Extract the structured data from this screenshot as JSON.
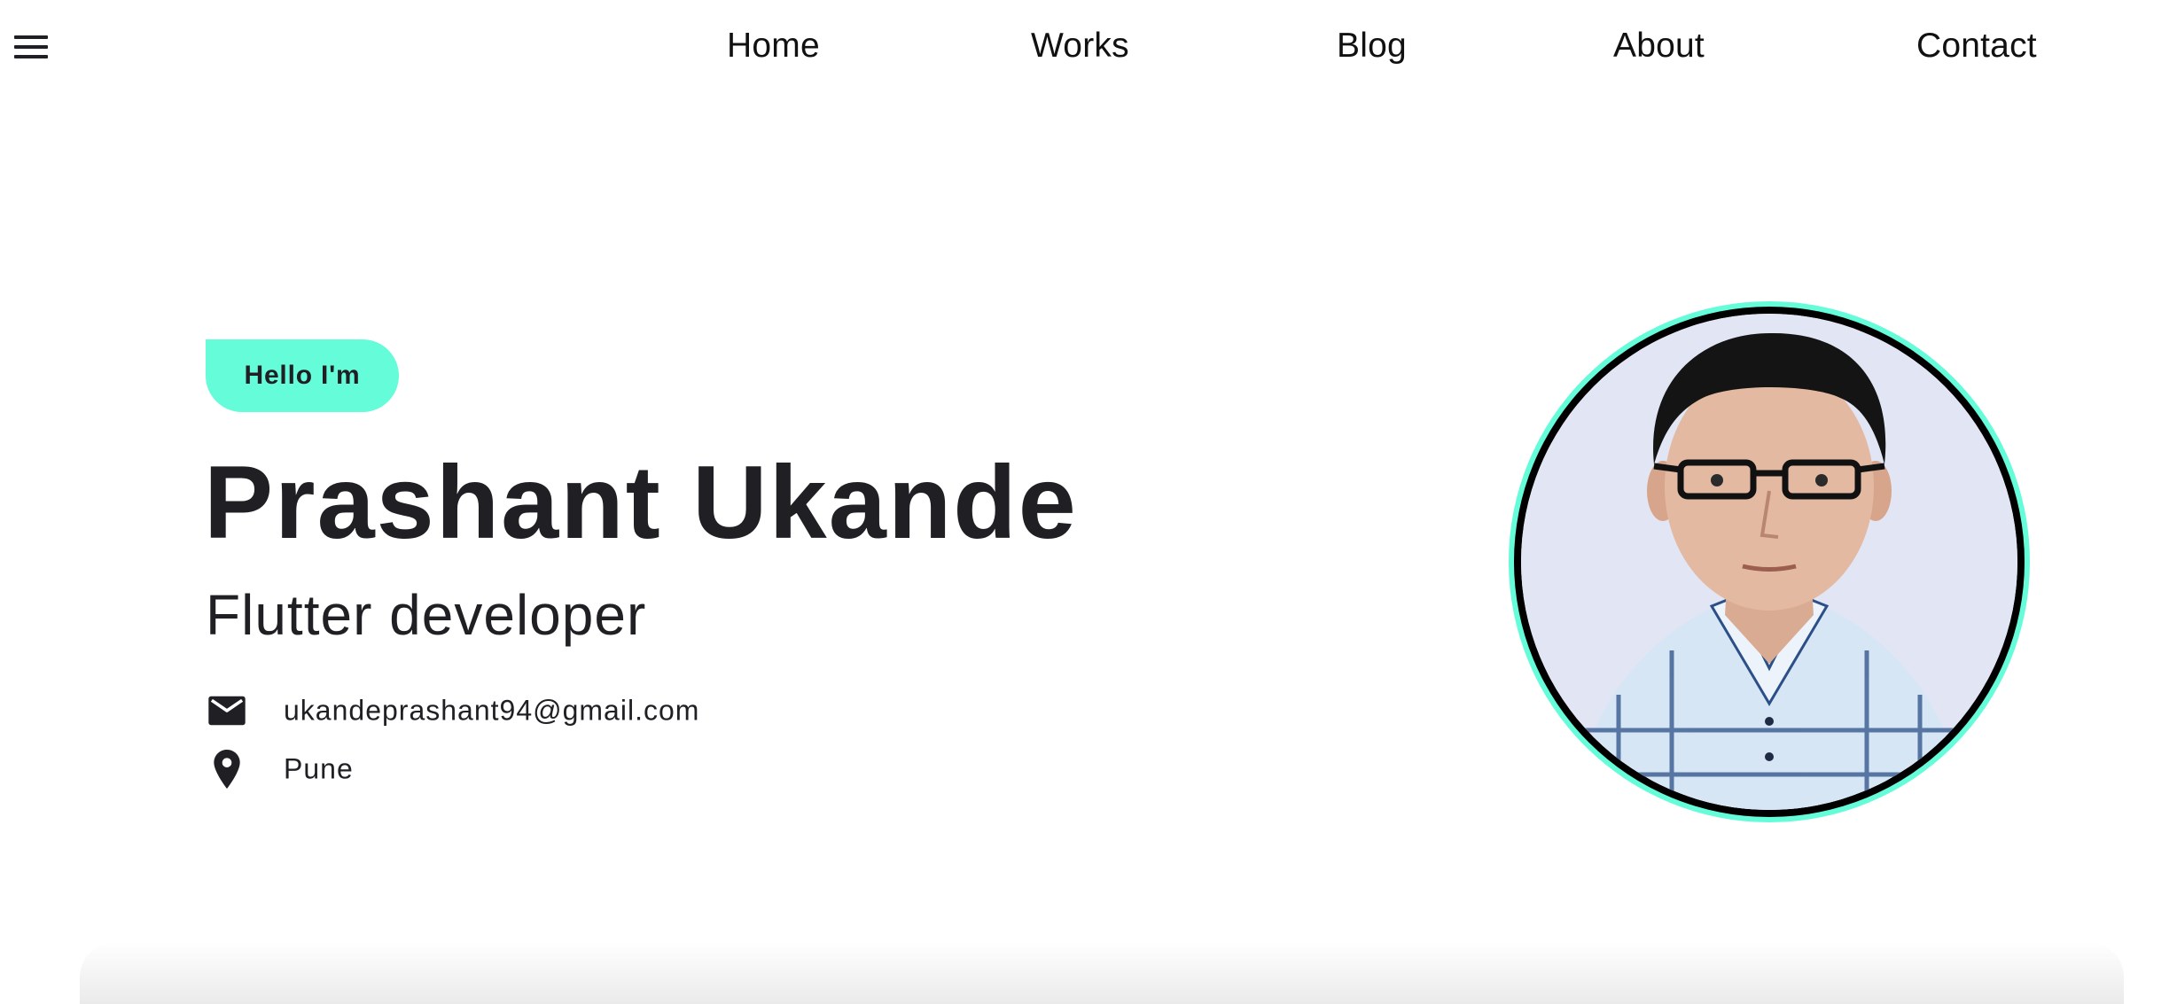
{
  "nav": {
    "menu_icon": "hamburger-menu-icon",
    "links": [
      "Home",
      "Works",
      "Blog",
      "About",
      "Contact"
    ]
  },
  "hero": {
    "greeting": "Hello I'm",
    "name": "Prashant Ukande",
    "role": "Flutter developer",
    "email": "ukandeprashant94@gmail.com",
    "email_icon": "mail-icon",
    "location": "Pune",
    "location_icon": "location-pin-icon"
  },
  "avatar": {
    "description_icon": "profile-photo"
  },
  "colors": {
    "accent": "#64fcd9",
    "text": "#1f1f24",
    "background": "#ffffff"
  }
}
